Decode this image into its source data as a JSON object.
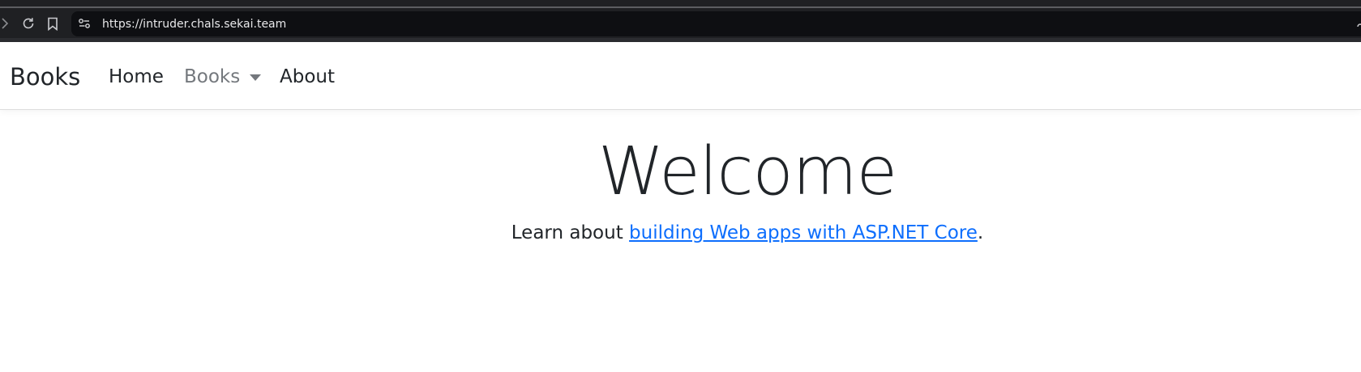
{
  "browser": {
    "url": "https://intruder.chals.sekai.team",
    "icons": [
      "forward-icon",
      "reload-icon",
      "bookmark-icon",
      "site-info-icon"
    ]
  },
  "navbar": {
    "brand": "Books",
    "items": [
      {
        "label": "Home"
      },
      {
        "label": "Books",
        "has_dropdown": true,
        "state": "muted"
      },
      {
        "label": "About"
      }
    ]
  },
  "main": {
    "heading": "Welcome",
    "lead_prefix": "Learn about ",
    "lead_link": "building Web apps with ASP.NET Core",
    "lead_suffix": "."
  },
  "colors": {
    "link": "#0d6efd",
    "text": "#212529",
    "muted_nav": "#74787d",
    "chrome_bg": "#1f2023"
  }
}
